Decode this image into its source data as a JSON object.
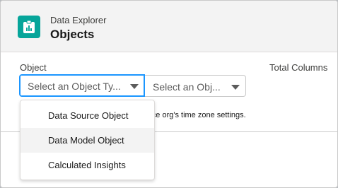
{
  "header": {
    "eyebrow": "Data Explorer",
    "title": "Objects",
    "icon": "objects-icon",
    "icon_color": "#06a59a"
  },
  "fields": {
    "object_label": "Object",
    "total_columns_label": "Total Columns",
    "object_type_select": {
      "value": "Select an Object Ty...",
      "icon": "chevron-down-icon",
      "focus_color": "#1b96ff"
    },
    "object_select": {
      "value": "Select an Obj...",
      "icon": "chevron-down-icon"
    }
  },
  "helper_text": "orce org's time zone settings.",
  "dropdown": {
    "options": [
      {
        "label": "Data Source Object"
      },
      {
        "label": "Data Model Object"
      },
      {
        "label": "Calculated Insights"
      }
    ]
  }
}
